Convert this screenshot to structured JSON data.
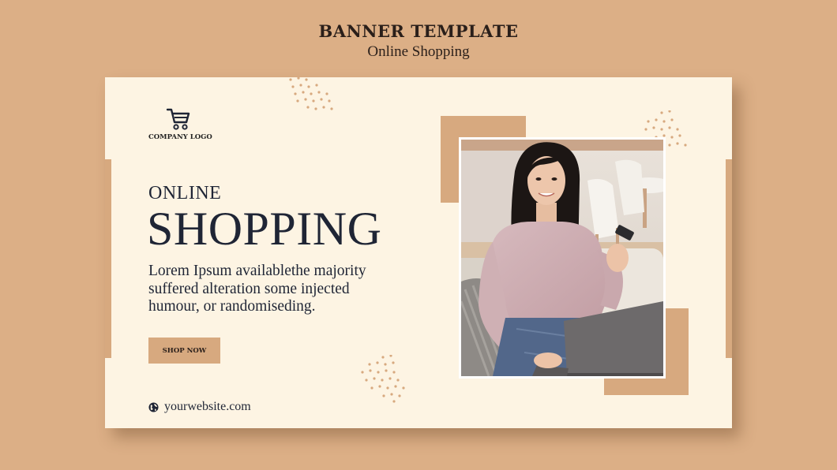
{
  "header": {
    "title": "BANNER TEMPLATE",
    "subtitle": "Online Shopping"
  },
  "banner": {
    "logo_icon": "shopping-cart-icon",
    "logo_text": "COMPANY LOGO",
    "heading_small": "ONLINE",
    "heading_big": "SHOPPING",
    "body_lines": [
      "Lorem Ipsum availablethe majority",
      "suffered alteration some injected",
      "humour, or randomiseding."
    ],
    "button_label": "SHOP NOW",
    "website_icon": "globe-icon",
    "website": "yourwebsite.com",
    "photo_description_icon": "photo"
  },
  "colors": {
    "background": "#dcaf86",
    "banner": "#fdf4e3",
    "accent": "#d7a97f",
    "text": "#1f2535"
  }
}
